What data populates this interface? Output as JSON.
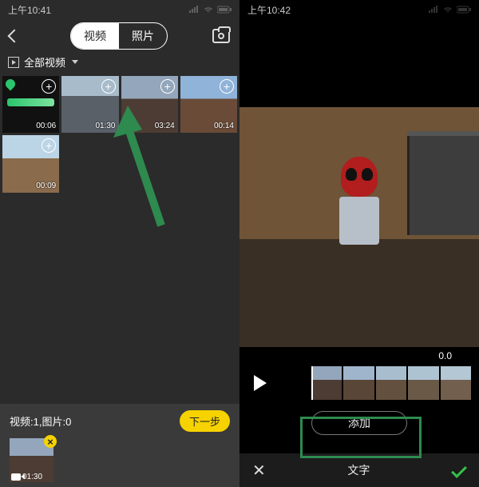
{
  "left": {
    "status_time": "上午10:41",
    "tabs": {
      "video": "视频",
      "photo": "照片",
      "active": "video"
    },
    "folder_label": "全部视频",
    "thumbs": [
      {
        "duration": "00:06"
      },
      {
        "duration": "01:30"
      },
      {
        "duration": "03:24"
      },
      {
        "duration": "00:14"
      },
      {
        "duration": "00:09"
      }
    ],
    "tray": {
      "summary": "视频:1,图片:0",
      "next": "下一步",
      "selected_duration": "01:30"
    }
  },
  "right": {
    "status_time": "上午10:42",
    "cursor_time": "0.0",
    "add_label": "添加",
    "bottom_tab": "文字"
  }
}
